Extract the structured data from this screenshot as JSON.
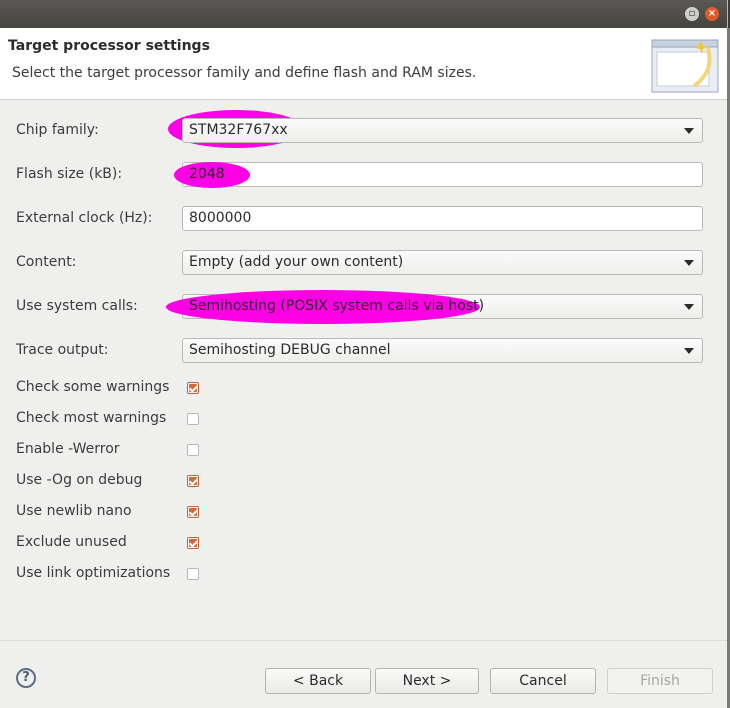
{
  "banner": {
    "title": "Target processor settings",
    "description": "Select the target processor family and define flash and RAM sizes."
  },
  "form": {
    "chip_family": {
      "label": "Chip family:",
      "value": "STM32F767xx"
    },
    "flash_size": {
      "label": "Flash size (kB):",
      "value": "2048"
    },
    "external_clock": {
      "label": "External clock (Hz):",
      "value": "8000000"
    },
    "content": {
      "label": "Content:",
      "value": "Empty (add your own content)"
    },
    "system_calls": {
      "label": "Use system calls:",
      "value": "Semihosting (POSIX system calls via host)"
    },
    "trace_output": {
      "label": "Trace output:",
      "value": "Semihosting DEBUG channel"
    }
  },
  "checkboxes": [
    {
      "label": "Check some warnings",
      "checked": true
    },
    {
      "label": "Check most warnings",
      "checked": false
    },
    {
      "label": "Enable -Werror",
      "checked": false
    },
    {
      "label": "Use -Og on debug",
      "checked": true
    },
    {
      "label": "Use newlib nano",
      "checked": true
    },
    {
      "label": "Exclude unused",
      "checked": true
    },
    {
      "label": "Use link optimizations",
      "checked": false
    }
  ],
  "buttons": {
    "help": "?",
    "back": "< Back",
    "next": "Next >",
    "cancel": "Cancel",
    "finish": "Finish"
  },
  "colors": {
    "highlight": "#ff00e6",
    "check_accent": "#d2693a"
  }
}
